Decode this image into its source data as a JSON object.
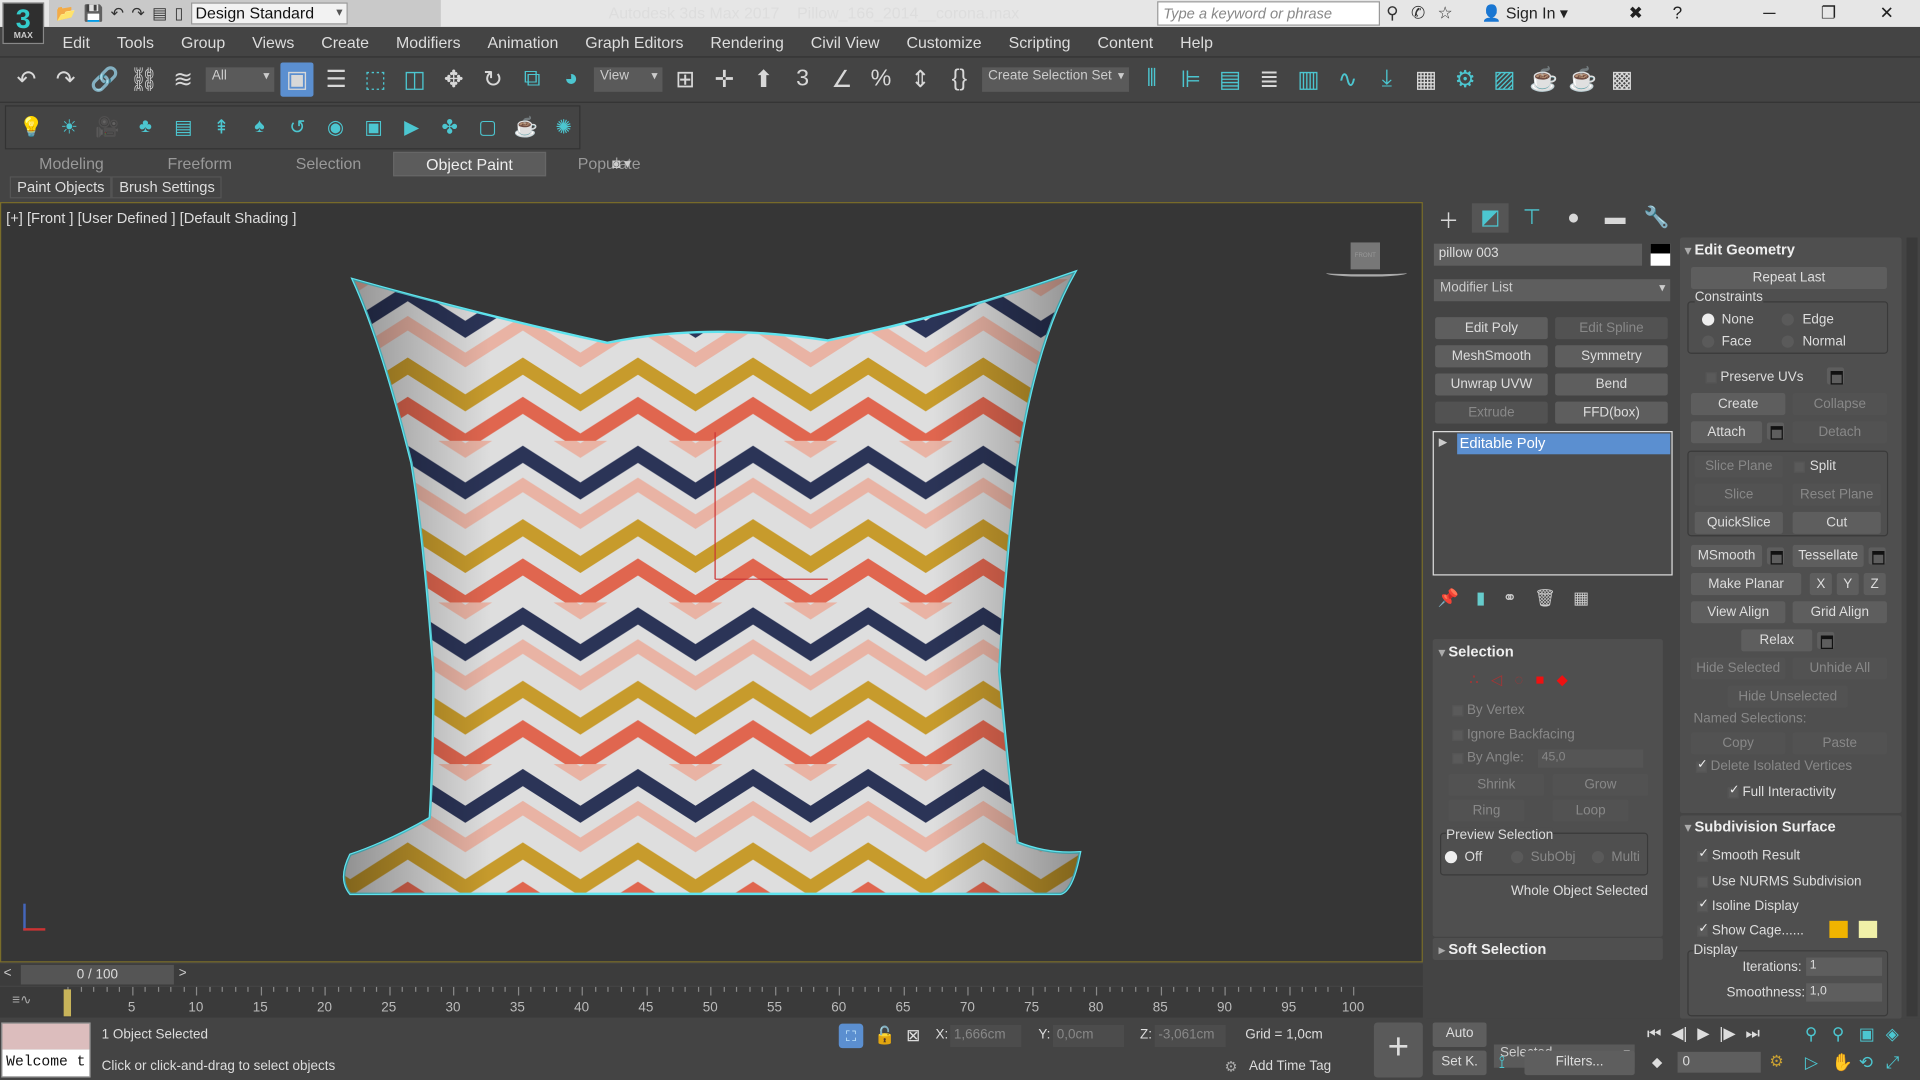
{
  "titlebar": {
    "app": "Autodesk 3ds Max 2017",
    "file": "Pillow_166_2014__corona.max",
    "logo": "3",
    "logo_sub": "MAX",
    "workspace": "Design Standard",
    "search_placeholder": "Type a keyword or phrase",
    "sign_in": "Sign In",
    "minimize": "─",
    "maximize": "❐",
    "close": "✕"
  },
  "menu": [
    "Edit",
    "Tools",
    "Group",
    "Views",
    "Create",
    "Modifiers",
    "Animation",
    "Graph Editors",
    "Rendering",
    "Civil View",
    "Customize",
    "Scripting",
    "Content",
    "Help"
  ],
  "toolbar": {
    "filter": "All",
    "refcoord": "View",
    "selection_set": "Create Selection Set",
    "icons": [
      "undo-icon",
      "redo-icon",
      "link-icon",
      "unlink-icon",
      "bind-spacewarp-icon",
      "|filter",
      "select-object-icon",
      "select-by-name-icon",
      "rect-selection-icon",
      "window-crossing-icon",
      "move-icon",
      "rotate-icon",
      "scale-icon",
      "place-icon",
      "|refcoord",
      "pivot-icon",
      "select-manipulate-icon",
      "keyboard-shortcut-icon",
      "snaps-icon",
      "angle-snap-icon",
      "percent-snap-icon",
      "spinner-snap-icon",
      "edit-named-sets-icon",
      "|selset",
      "mirror-icon",
      "align-icon",
      "layer-explorer-icon",
      "toggle-ribbon-icon",
      "scene-explorer-icon",
      "curve-editor-icon",
      "schematic-icon",
      "material-editor-icon",
      "render-setup-icon",
      "rendered-frame-icon",
      "render-icon",
      "render-iterative-icon",
      "arnold-icon"
    ]
  },
  "toolbar2": {
    "icons": [
      "light-icon",
      "sun-icon",
      "camera-icon",
      "trees-icon",
      "list-icon",
      "pine-icon",
      "tree-icon",
      "reset-icon",
      "material-icon",
      "frame-icon",
      "render-region-icon",
      "camera-add-icon",
      "window-icon",
      "teapot-icon",
      "bulb-icon"
    ]
  },
  "ribbon": {
    "tabs": [
      "Modeling",
      "Freeform",
      "Selection",
      "Object Paint",
      "Populate"
    ],
    "active": "Object Paint",
    "subtabs": [
      "Paint Objects",
      "Brush Settings"
    ]
  },
  "viewport": {
    "label": "[+] [Front ] [User Defined ] [Default Shading ]",
    "viewcube": "FRONT",
    "colors": {
      "navy": "#2b3457",
      "coral": "#e0664f",
      "mustard": "#c79b2c",
      "pink": "#e9b3a4",
      "white": "#dedede",
      "outline": "#5fe3ee"
    }
  },
  "command_panel": {
    "object_name": "pillow 003",
    "modifier_list": "Modifier List",
    "modifier_buttons": [
      {
        "label": "Edit Poly",
        "enabled": true
      },
      {
        "label": "Edit Spline",
        "enabled": false
      },
      {
        "label": "MeshSmooth",
        "enabled": true
      },
      {
        "label": "Symmetry",
        "enabled": true
      },
      {
        "label": "Unwrap UVW",
        "enabled": true
      },
      {
        "label": "Bend",
        "enabled": true
      },
      {
        "label": "Extrude",
        "enabled": false
      },
      {
        "label": "FFD(box)",
        "enabled": true
      }
    ],
    "stack": [
      "Editable Poly"
    ],
    "selection": {
      "title": "Selection",
      "by_vertex": "By Vertex",
      "ignore_backfacing": "Ignore Backfacing",
      "by_angle": "By Angle:",
      "angle": "45,0",
      "shrink": "Shrink",
      "grow": "Grow",
      "ring": "Ring",
      "loop": "Loop",
      "preview": "Preview Selection",
      "off": "Off",
      "subobj": "SubObj",
      "multi": "Multi",
      "status": "Whole Object Selected"
    },
    "soft_selection": "Soft Selection",
    "edit_geometry": {
      "title": "Edit Geometry",
      "repeat_last": "Repeat Last",
      "constraints": "Constraints",
      "none": "None",
      "edge": "Edge",
      "face": "Face",
      "normal": "Normal",
      "preserve_uvs": "Preserve UVs",
      "create": "Create",
      "collapse": "Collapse",
      "attach": "Attach",
      "detach": "Detach",
      "slice_plane": "Slice Plane",
      "split": "Split",
      "slice": "Slice",
      "reset_plane": "Reset Plane",
      "quickslice": "QuickSlice",
      "cut": "Cut",
      "msmooth": "MSmooth",
      "tessellate": "Tessellate",
      "make_planar": "Make Planar",
      "x": "X",
      "y": "Y",
      "z": "Z",
      "view_align": "View Align",
      "grid_align": "Grid Align",
      "relax": "Relax",
      "hide_selected": "Hide Selected",
      "unhide_all": "Unhide All",
      "hide_unselected": "Hide Unselected",
      "named_selections": "Named Selections:",
      "copy": "Copy",
      "paste": "Paste",
      "delete_isolated": "Delete Isolated Vertices",
      "full_interactivity": "Full Interactivity"
    },
    "subdivision": {
      "title": "Subdivision Surface",
      "smooth_result": "Smooth Result",
      "use_nurms": "Use NURMS Subdivision",
      "isoline": "Isoline Display",
      "show_cage": "Show Cage......",
      "display": "Display",
      "iterations_label": "Iterations:",
      "iterations": "1",
      "smoothness_label": "Smoothness:",
      "smoothness": "1,0",
      "cage_color1": "#f0b400",
      "cage_color2": "#f0f0a8"
    }
  },
  "timeline": {
    "frame": "0 / 100",
    "prev": "<",
    "next": ">",
    "ticks": [
      "5",
      "10",
      "15",
      "20",
      "25",
      "30",
      "35",
      "40",
      "45",
      "50",
      "55",
      "60",
      "65",
      "70",
      "75",
      "80",
      "85",
      "90",
      "95",
      "100"
    ]
  },
  "status": {
    "welcome": "Welcome t",
    "selected": "1 Object Selected",
    "prompt": "Click or click-and-drag to select objects",
    "x_label": "X:",
    "x": "1,666cm",
    "y_label": "Y:",
    "y": "0,0cm",
    "z_label": "Z:",
    "z": "-3,061cm",
    "grid": "Grid = 1,0cm",
    "add_time_tag": "Add Time Tag",
    "auto": "Auto",
    "set_key": "Set K.",
    "key_filter": "Selected",
    "filters": "Filters...",
    "current_frame": "0"
  }
}
